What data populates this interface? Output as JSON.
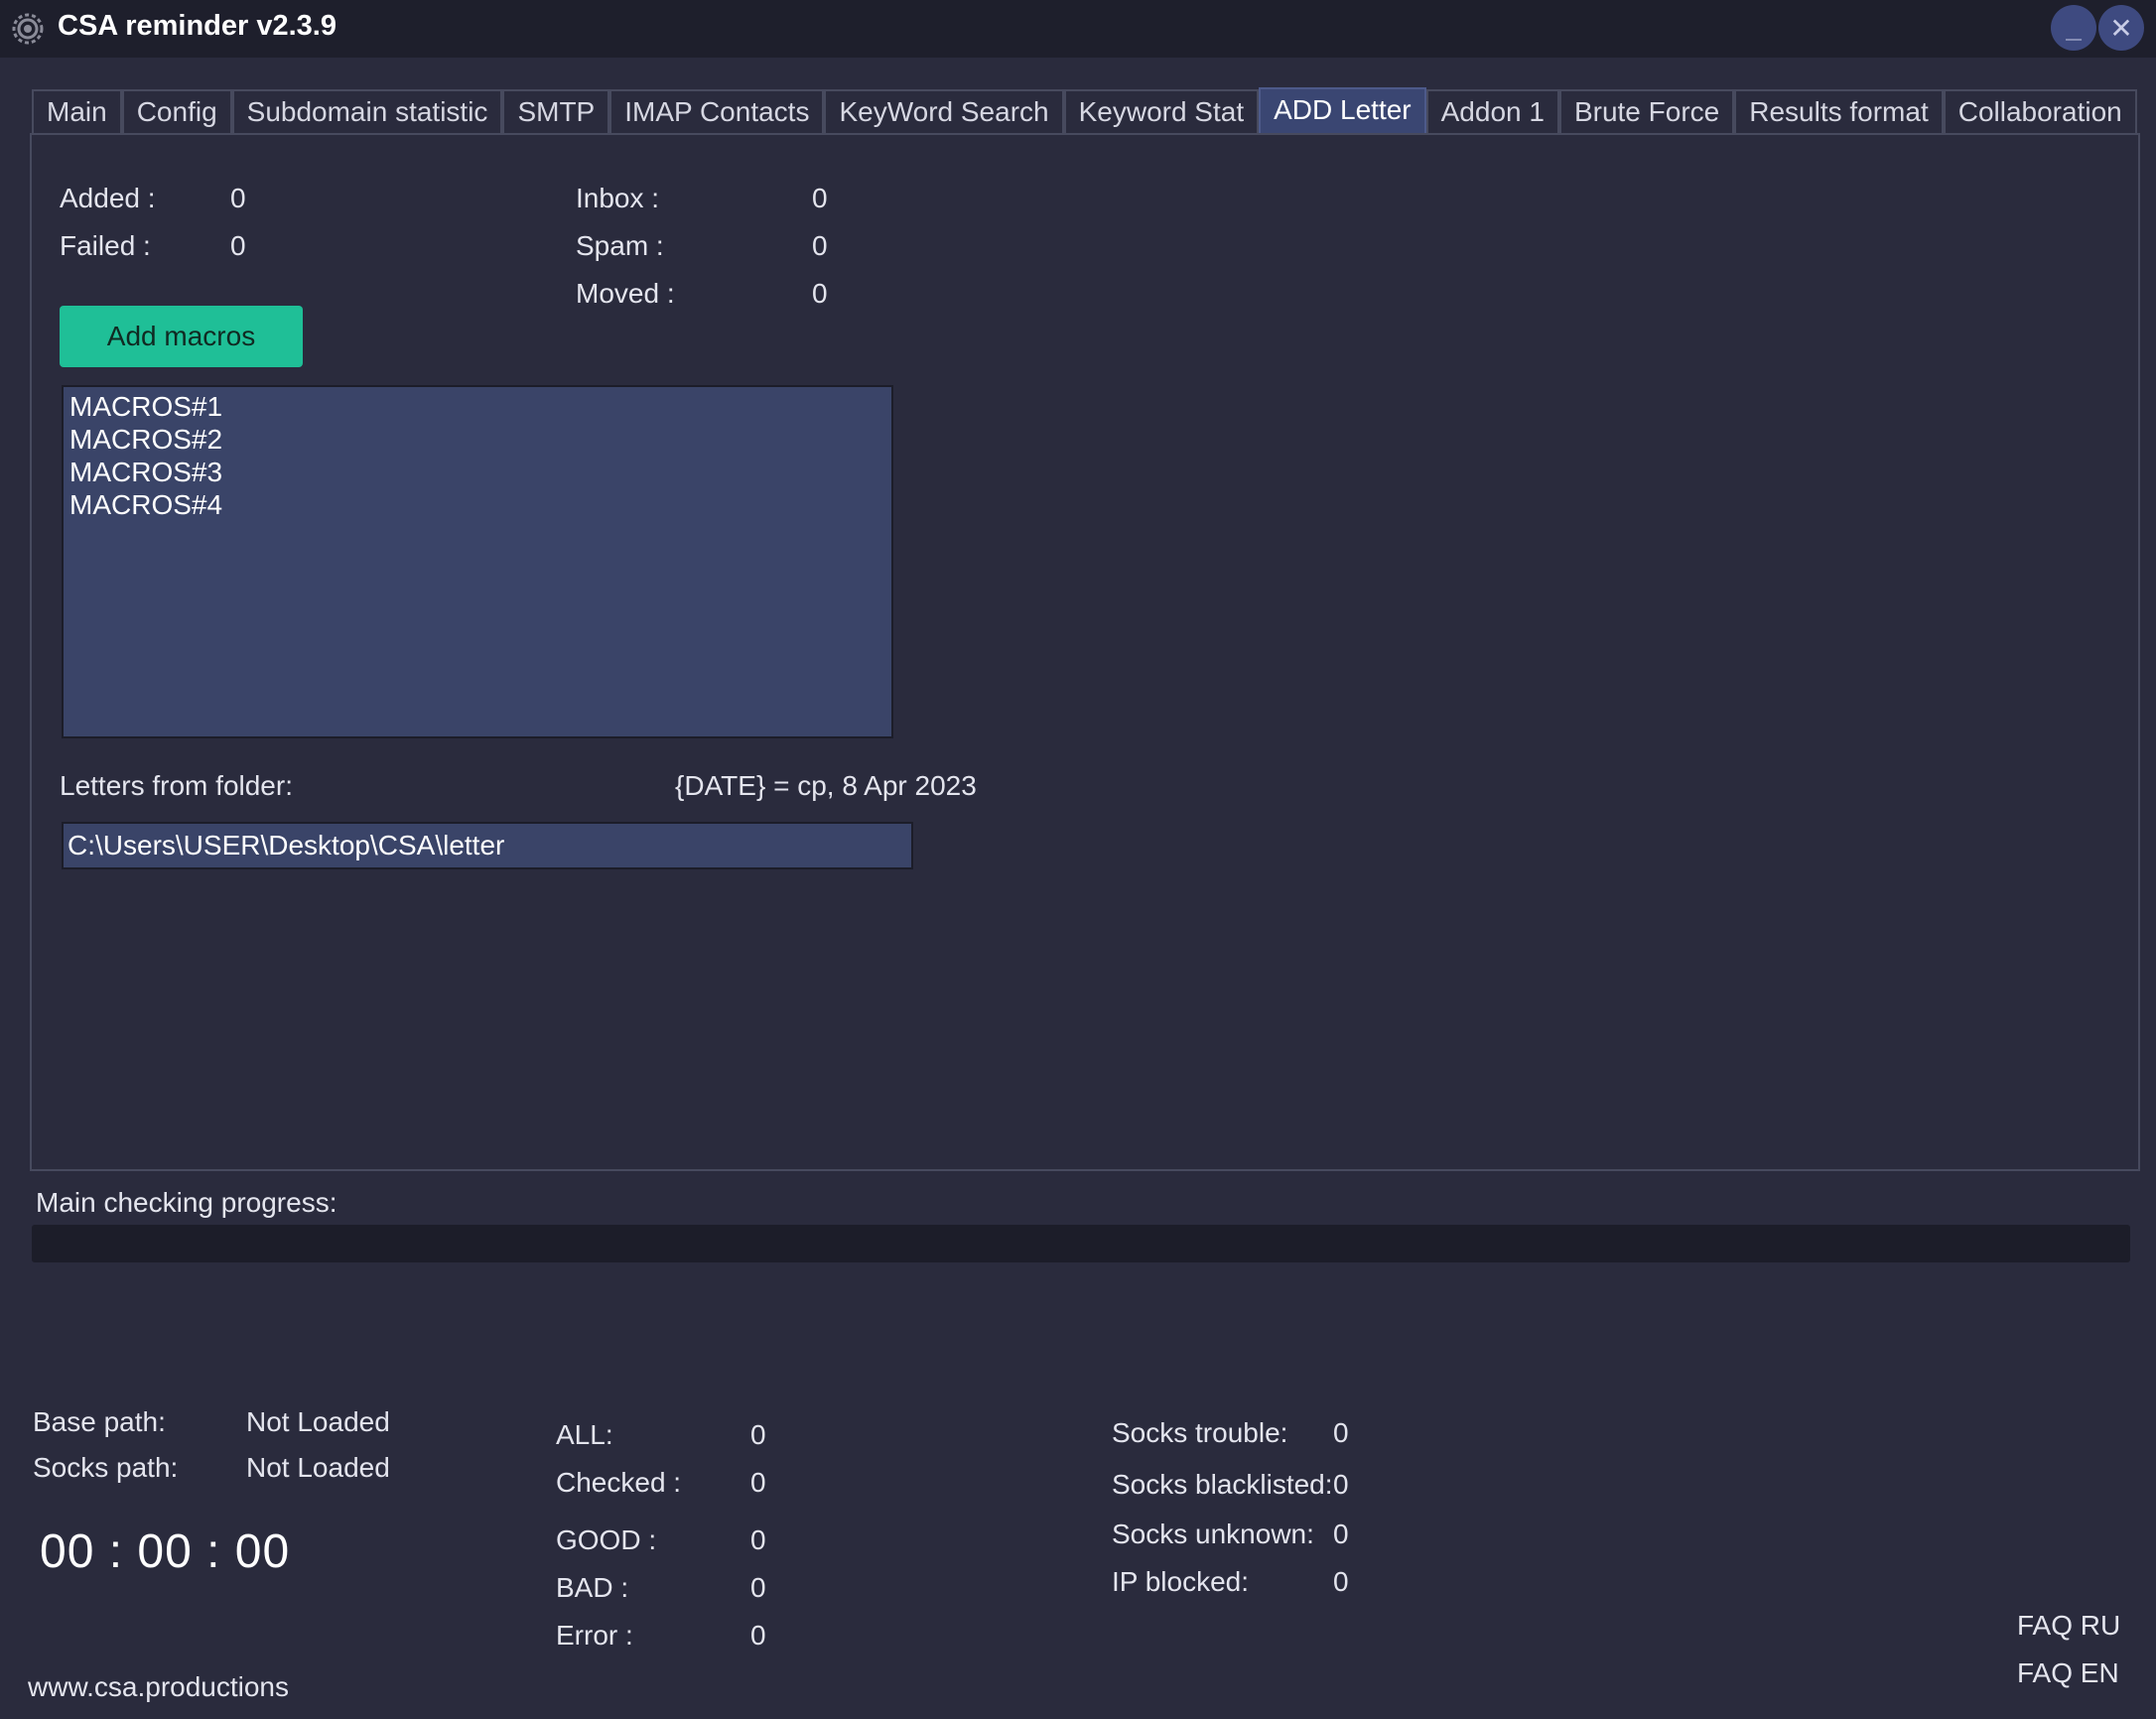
{
  "window": {
    "title": "CSA reminder v2.3.9",
    "minimize_glyph": "_",
    "close_glyph": "✕",
    "accent_color": "#1fbf97",
    "active_tab_color": "#3a4672"
  },
  "tabs": [
    {
      "label": "Main",
      "active": false
    },
    {
      "label": "Config",
      "active": false
    },
    {
      "label": "Subdomain statistic",
      "active": false
    },
    {
      "label": "SMTP",
      "active": false
    },
    {
      "label": "IMAP Contacts",
      "active": false
    },
    {
      "label": "KeyWord Search",
      "active": false
    },
    {
      "label": "Keyword Stat",
      "active": false
    },
    {
      "label": "ADD Letter",
      "active": true
    },
    {
      "label": "Addon 1",
      "active": false
    },
    {
      "label": "Brute Force",
      "active": false
    },
    {
      "label": "Results format",
      "active": false
    },
    {
      "label": "Collaboration",
      "active": false
    }
  ],
  "add_letter": {
    "added_label": "Added :",
    "added_value": "0",
    "failed_label": "Failed :",
    "failed_value": "0",
    "inbox_label": "Inbox :",
    "inbox_value": "0",
    "spam_label": "Spam :",
    "spam_value": "0",
    "moved_label": "Moved :",
    "moved_value": "0",
    "add_macros_button": "Add macros",
    "macros": [
      "MACROS#1",
      "MACROS#2",
      "MACROS#3",
      "MACROS#4"
    ],
    "letters_folder_label": "Letters from folder:",
    "date_macro": "{DATE} = cp, 8 Apr 2023",
    "folder_path": "C:\\Users\\USER\\Desktop\\CSA\\letter"
  },
  "progress": {
    "label": "Main checking progress:",
    "value_percent": 0
  },
  "footer": {
    "base_path_label": "Base path:",
    "base_path_value": "Not Loaded",
    "socks_path_label": "Socks path:",
    "socks_path_value": "Not Loaded",
    "timer": "00 : 00 : 00",
    "stats": {
      "all_label": "ALL:",
      "all_value": "0",
      "checked_label": "Checked :",
      "checked_value": "0",
      "good_label": "GOOD :",
      "good_value": "0",
      "bad_label": "BAD :",
      "bad_value": "0",
      "error_label": "Error :",
      "error_value": "0"
    },
    "socks": {
      "trouble_label": "Socks trouble:",
      "trouble_value": "0",
      "blacklisted_label": "Socks blacklisted:",
      "blacklisted_value": "0",
      "unknown_label": "Socks unknown:",
      "unknown_value": "0",
      "ip_blocked_label": "IP blocked:",
      "ip_blocked_value": "0"
    },
    "faq_ru": "FAQ RU",
    "faq_en": "FAQ EN",
    "website": "www.csa.productions"
  }
}
